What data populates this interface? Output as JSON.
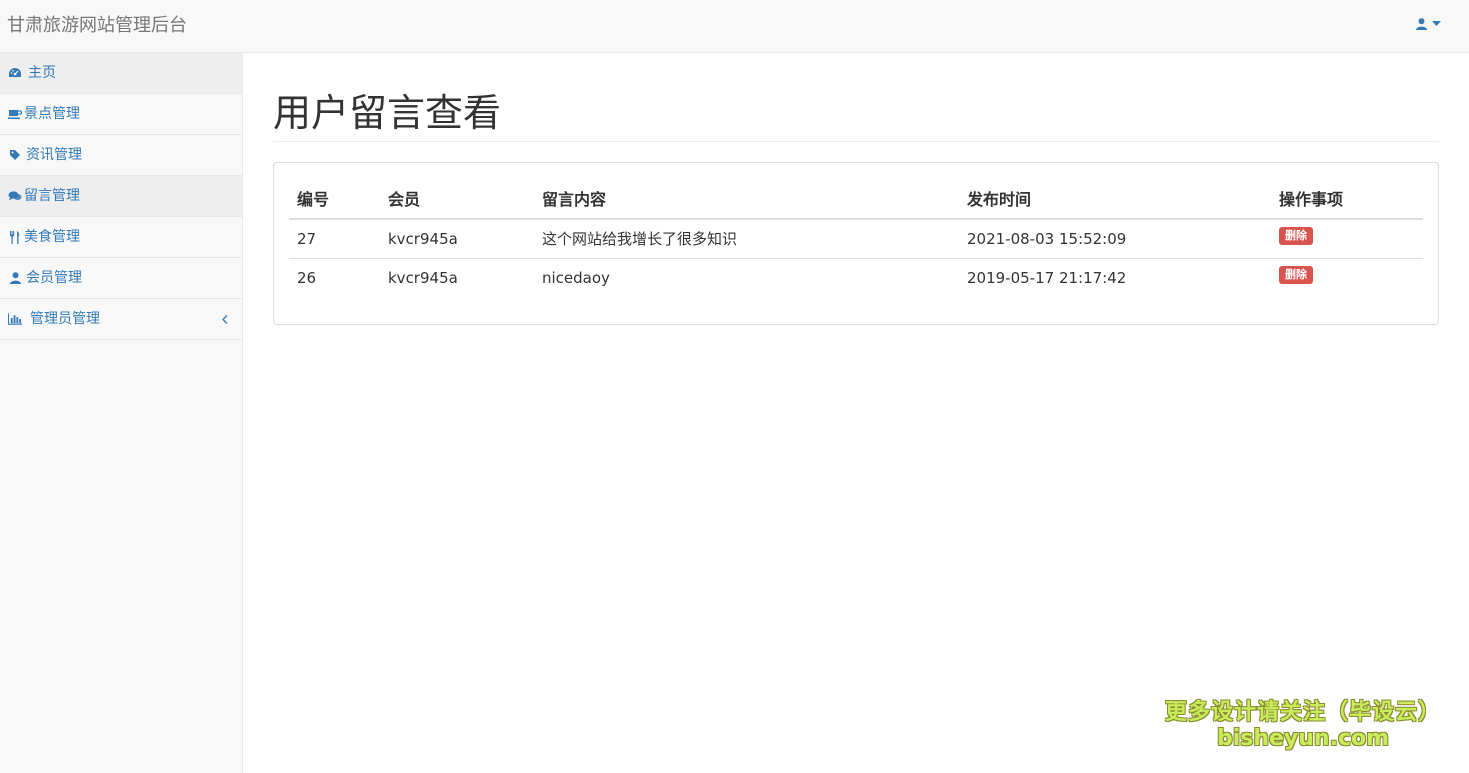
{
  "header": {
    "brand": "甘肃旅游网站管理后台",
    "user_icon": "user-icon",
    "caret_icon": "caret-down-icon"
  },
  "sidebar": {
    "items": [
      {
        "label": "主页",
        "icon": "dashboard-icon",
        "active": true
      },
      {
        "label": "景点管理",
        "icon": "coffee-icon",
        "active": false
      },
      {
        "label": "资讯管理",
        "icon": "tag-icon",
        "active": false
      },
      {
        "label": "留言管理",
        "icon": "comments-icon",
        "active": true
      },
      {
        "label": "美食管理",
        "icon": "cutlery-icon",
        "active": false
      },
      {
        "label": "会员管理",
        "icon": "user-icon",
        "active": false
      },
      {
        "label": "管理员管理",
        "icon": "bar-chart-icon",
        "active": false,
        "chevron": "chevron-left-icon"
      }
    ]
  },
  "main": {
    "title": "用户留言查看",
    "table": {
      "headers": [
        "编号",
        "会员",
        "留言内容",
        "发布时间",
        "操作事项"
      ],
      "rows": [
        {
          "id": "27",
          "member": "kvcr945a",
          "content": "这个网站给我增长了很多知识",
          "time": "2021-08-03 15:52:09",
          "action": "删除"
        },
        {
          "id": "26",
          "member": "kvcr945a",
          "content": "nicedaoy",
          "time": "2019-05-17 21:17:42",
          "action": "删除"
        }
      ]
    }
  },
  "watermark": {
    "line1": "更多设计请关注（毕设云）",
    "line2": "bisheyun.com"
  },
  "colors": {
    "link": "#337ab7",
    "danger": "#d9534f",
    "sidebar_bg": "#f8f8f8",
    "active_bg": "#eeeeee"
  }
}
